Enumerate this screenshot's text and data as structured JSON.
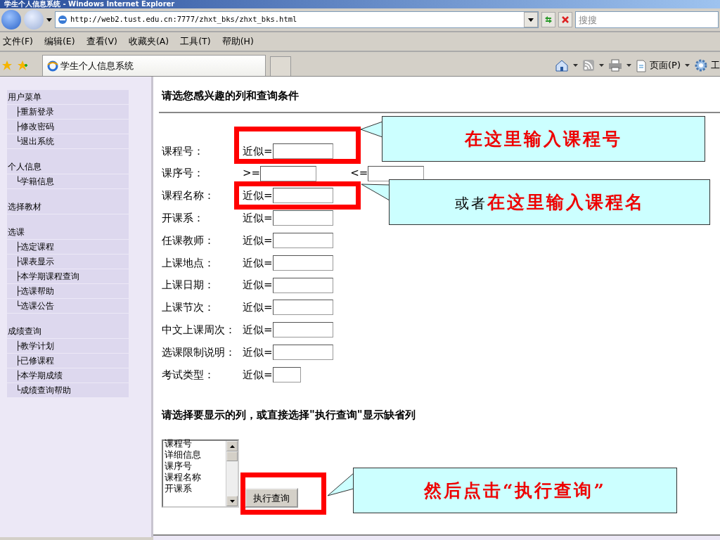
{
  "window": {
    "title": "学生个人信息系统 - Windows Internet Explorer"
  },
  "address_bar": {
    "url": "http://web2.tust.edu.cn:7777/zhxt_bks/zhxt_bks.html"
  },
  "search": {
    "placeholder": "搜搜"
  },
  "menu": [
    "文件(F)",
    "编辑(E)",
    "查看(V)",
    "收藏夹(A)",
    "工具(T)",
    "帮助(H)"
  ],
  "tabs": [
    {
      "label": "学生个人信息系统",
      "selected": true
    }
  ],
  "command_bar": [
    {
      "kind": "home"
    },
    {
      "kind": "feed"
    },
    {
      "kind": "print"
    },
    {
      "kind": "page",
      "label": "页面(P)"
    },
    {
      "kind": "tools",
      "label": "工"
    }
  ],
  "sidebar": [
    {
      "label": "用户菜单",
      "children": [
        {
          "label": "├重新登录"
        },
        {
          "label": "├修改密码"
        },
        {
          "label": "└退出系统"
        }
      ]
    },
    {
      "label": "个人信息",
      "children": [
        {
          "label": "└学籍信息"
        }
      ]
    },
    {
      "label": "选择教材"
    },
    {
      "label": "选课",
      "children": [
        {
          "label": "├选定课程"
        },
        {
          "label": "├课表显示"
        },
        {
          "label": "├本学期课程查询"
        },
        {
          "label": "├选课帮助"
        },
        {
          "label": "└选课公告"
        }
      ]
    },
    {
      "label": "成绩查询",
      "children": [
        {
          "label": "├教学计划"
        },
        {
          "label": "├已修课程"
        },
        {
          "label": "├本学期成绩"
        },
        {
          "label": "└成绩查询帮助"
        }
      ]
    }
  ],
  "main": {
    "heading": "请选您感兴趣的列和查询条件",
    "criteria": [
      {
        "kind": "like",
        "label": "课程号：",
        "prefix": "近似=",
        "wide": true
      },
      {
        "kind": "range",
        "label": "课序号：",
        "from": ">=",
        "to": "<="
      },
      {
        "kind": "like",
        "label": "课程名称：",
        "prefix": "近似=",
        "wide": true
      },
      {
        "kind": "like",
        "label": "开课系：",
        "prefix": "近似=",
        "wide": true
      },
      {
        "kind": "like",
        "label": "任课教师：",
        "prefix": "近似=",
        "wide": true
      },
      {
        "kind": "like",
        "label": "上课地点：",
        "prefix": "近似=",
        "wide": true
      },
      {
        "kind": "like",
        "label": "上课日期：",
        "prefix": "近似=",
        "wide": true
      },
      {
        "kind": "like",
        "label": "上课节次：",
        "prefix": "近似=",
        "wide": true
      },
      {
        "kind": "like",
        "label": "中文上课周次：",
        "prefix": "近似=",
        "wide": true
      },
      {
        "kind": "like",
        "label": "选课限制说明：",
        "prefix": "近似=",
        "wide": true
      },
      {
        "kind": "like",
        "label": "考试类型：",
        "prefix": "近似=",
        "wide": false
      }
    ],
    "columns_heading": "请选择要显示的列，或直接选择\"执行查询\"显示缺省列",
    "columns_list": [
      "课程号",
      "详细信息",
      "课序号",
      "课程名称",
      "开课系"
    ],
    "query_button": "执行查询"
  },
  "annotations": [
    {
      "text": "在这里输入课程号"
    },
    {
      "lead": "或者",
      "text": "在这里输入课程名"
    },
    {
      "text": "然后点击“执行查询”"
    }
  ]
}
